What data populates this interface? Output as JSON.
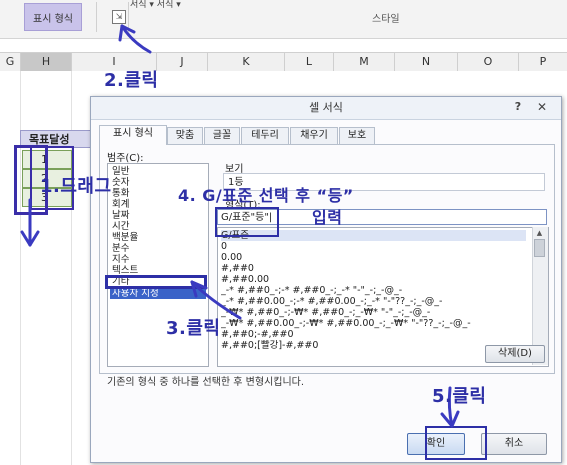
{
  "ribbon": {
    "group_label": "표시 형식",
    "small_labels": "서식 ▾  서식 ▾",
    "style_label": "스타일",
    "launcher_icon": "dialog-launcher-icon"
  },
  "columns": [
    "G",
    "H",
    "I",
    "J",
    "K",
    "L",
    "M",
    "N",
    "O",
    "P"
  ],
  "sheet": {
    "header_cell": "목표달성",
    "values": [
      "1",
      "2",
      "3"
    ]
  },
  "annotations": {
    "click2": "2.클릭",
    "drag1": "1.드래그",
    "gformat": "4. G/표준 선택 후 “등”",
    "input": "입력",
    "click3": "3.클릭",
    "click5": "5.클릭",
    "color": "#2d2fa6"
  },
  "dialog": {
    "title": "셀 서식",
    "help": "?",
    "close": "✕",
    "tabs": [
      "표시 형식",
      "맞춤",
      "글꼴",
      "테두리",
      "채우기",
      "보호"
    ],
    "category_label": "범주(C):",
    "categories": [
      "일반",
      "숫자",
      "통화",
      "회계",
      "날짜",
      "시간",
      "백분율",
      "분수",
      "지수",
      "텍스트",
      "기타",
      "사용자 지정"
    ],
    "selected_category": "사용자 지정",
    "sample_label": "보기",
    "sample_value": "1등",
    "type_label": "형식(T):",
    "type_value": "G/표준\"등\"|",
    "formats": [
      "G/표준",
      "0",
      "0.00",
      "#,##0",
      "#,##0.00",
      "_-* #,##0_-;-* #,##0_-;_-* \"-\"_-;_-@_-",
      "_-* #,##0.00_-;-* #,##0.00_-;_-* \"-\"??_-;_-@_-",
      "_-₩* #,##0_-;-₩* #,##0_-;_-₩* \"-\"_-;_-@_-",
      "_-₩* #,##0.00_-;-₩* #,##0.00_-;_-₩* \"-\"??_-;_-@_-",
      "#,##0;-#,##0",
      "#,##0;[빨강]-#,##0"
    ],
    "delete_label": "삭제(D)",
    "description": "기존의 형식 중 하나를 선택한 후 변형시킵니다.",
    "ok_label": "확인",
    "cancel_label": "취소"
  }
}
